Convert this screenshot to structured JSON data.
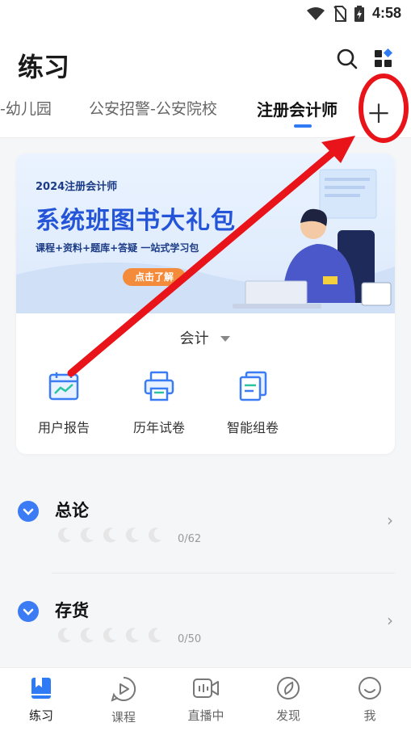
{
  "status_bar": {
    "time": "4:58"
  },
  "header": {
    "title": "练习"
  },
  "tabs": [
    {
      "label": "-幼儿园"
    },
    {
      "label": "公安招警-公安院校"
    },
    {
      "label": "注册会计师"
    }
  ],
  "banner": {
    "year_line": "2024注册会计师",
    "title": "系统班图书大礼包",
    "subtitle": "课程+资料+题库+答疑 一站式学习包",
    "cta": "点击了解"
  },
  "subject": {
    "selected": "会计"
  },
  "tools": [
    {
      "label": "用户报告",
      "icon": "report-chart-icon"
    },
    {
      "label": "历年试卷",
      "icon": "printer-icon"
    },
    {
      "label": "智能组卷",
      "icon": "stacked-documents-icon"
    }
  ],
  "chapters": [
    {
      "title": "总论",
      "progress": "0/62"
    },
    {
      "title": "存货",
      "progress": "0/50"
    }
  ],
  "bottom_nav": [
    {
      "label": "练习",
      "icon": "book-icon",
      "active": true
    },
    {
      "label": "课程",
      "icon": "play-course-icon",
      "active": false
    },
    {
      "label": "直播中",
      "icon": "live-video-icon",
      "active": false
    },
    {
      "label": "发现",
      "icon": "compass-icon",
      "active": false
    },
    {
      "label": "我",
      "icon": "smile-icon",
      "active": false
    }
  ],
  "colors": {
    "accent": "#2f7bf6",
    "annotation": "#e8141a",
    "cta": "#f48b3a"
  }
}
